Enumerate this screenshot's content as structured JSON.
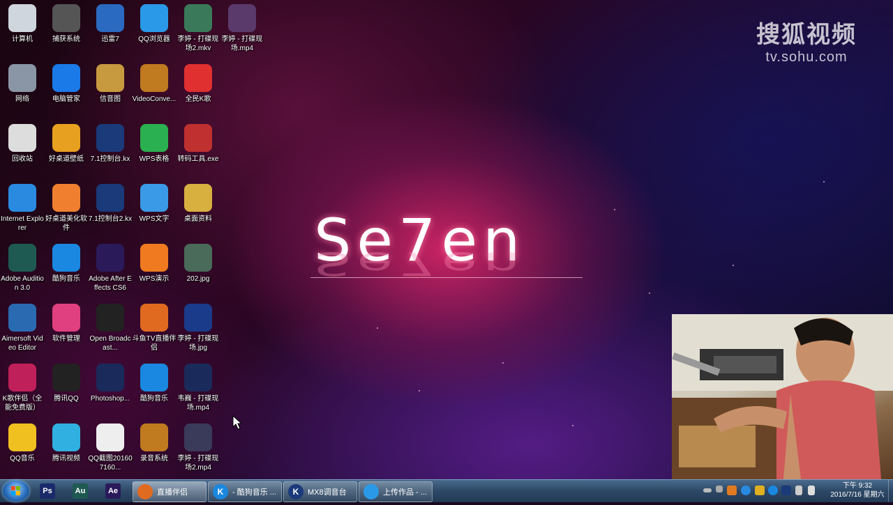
{
  "watermark": {
    "brand": "搜狐视频",
    "url": "tv.sohu.com"
  },
  "wallpaper_logo": {
    "text": "Se7en"
  },
  "desktop_icons": [
    {
      "label": "计算机",
      "icon": "computer-icon",
      "color": "#cfd6de"
    },
    {
      "label": "网络",
      "icon": "network-globe-icon",
      "color": "#8a96a6"
    },
    {
      "label": "回收站",
      "icon": "recycle-bin-icon",
      "color": "#dddddd"
    },
    {
      "label": "Internet Explorer",
      "icon": "internet-explorer-icon",
      "color": "#2a8ae0"
    },
    {
      "label": "Adobe Audition 3.0",
      "icon": "adobe-audition-icon",
      "color": "#1e5a52"
    },
    {
      "label": "Aimersoft Video Editor",
      "icon": "aimersoft-video-editor-icon",
      "color": "#2a6ab0"
    },
    {
      "label": "K歌伴侣（全能免费版）",
      "icon": "k-song-companion-icon",
      "color": "#c0205a"
    },
    {
      "label": "QQ音乐",
      "icon": "qq-music-icon",
      "color": "#f0c020"
    },
    {
      "label": "捕获系统",
      "icon": "capture-system-icon",
      "color": "#555555"
    },
    {
      "label": "电脑管家",
      "icon": "pc-manager-icon",
      "color": "#1a7ae8"
    },
    {
      "label": "好桌道壁纸",
      "icon": "wallpaper-app-icon",
      "color": "#e8a020"
    },
    {
      "label": "好桌道美化软件",
      "icon": "desktop-beautify-icon",
      "color": "#f08030"
    },
    {
      "label": "酷狗音乐",
      "icon": "kugou-music-icon",
      "color": "#1a88e0"
    },
    {
      "label": "软件管理",
      "icon": "software-manager-icon",
      "color": "#e04080"
    },
    {
      "label": "腾讯QQ",
      "icon": "tencent-qq-icon",
      "color": "#222222"
    },
    {
      "label": "腾讯视频",
      "icon": "tencent-video-icon",
      "color": "#30b0e0"
    },
    {
      "label": "迅雷7",
      "icon": "xunlei-thunder-icon",
      "color": "#2a6ac0"
    },
    {
      "label": "信音图",
      "icon": "folder-icon",
      "color": "#c89a40"
    },
    {
      "label": "7.1控制台.kx",
      "icon": "kx-console-icon",
      "color": "#1a3a7a"
    },
    {
      "label": "7.1控制台2.kx",
      "icon": "kx-console-icon",
      "color": "#1a3a7a"
    },
    {
      "label": "Adobe After Effects CS6",
      "icon": "after-effects-icon",
      "color": "#2a1a5a"
    },
    {
      "label": "Open Broadcast...",
      "icon": "obs-icon",
      "color": "#222222"
    },
    {
      "label": "Photoshop...",
      "icon": "photoshop-icon",
      "color": "#1a2a5a"
    },
    {
      "label": "QQ截图201607160...",
      "icon": "image-file-icon",
      "color": "#eeeeee"
    },
    {
      "label": "QQ浏览器",
      "icon": "qq-browser-icon",
      "color": "#2a9ae8"
    },
    {
      "label": "VideoConve...",
      "icon": "video-converter-icon",
      "color": "#c07a20"
    },
    {
      "label": "WPS表格",
      "icon": "wps-spreadsheet-icon",
      "color": "#2ab050"
    },
    {
      "label": "WPS文字",
      "icon": "wps-writer-icon",
      "color": "#3a9ae8"
    },
    {
      "label": "WPS演示",
      "icon": "wps-presentation-icon",
      "color": "#f07a20"
    },
    {
      "label": "斗鱼TV直播伴侣",
      "icon": "douyu-tv-icon",
      "color": "#e06a20"
    },
    {
      "label": "酷狗音乐",
      "icon": "kugou-music-icon",
      "color": "#1a88e0"
    },
    {
      "label": "录音系统",
      "icon": "recording-system-icon",
      "color": "#c07a20"
    },
    {
      "label": "李婷 - 打碟现场2.mkv",
      "icon": "mkv-video-icon",
      "color": "#3a7a5a"
    },
    {
      "label": "全民K歌",
      "icon": "quanmin-ksong-icon",
      "color": "#e03030"
    },
    {
      "label": "转码工具.exe",
      "icon": "transcoder-icon",
      "color": "#c03030"
    },
    {
      "label": "桌面资料",
      "icon": "folder-icon",
      "color": "#d8b040"
    },
    {
      "label": "202.jpg",
      "icon": "image-file-icon",
      "color": "#4a6a5a"
    },
    {
      "label": "李婷 - 打碟现场.jpg",
      "icon": "image-file-icon",
      "color": "#1a3a8a"
    },
    {
      "label": "韦巍 - 打碟现场.mp4",
      "icon": "mp4-video-icon",
      "color": "#1a2a5a"
    },
    {
      "label": "李婷 - 打碟现场2.mp4",
      "icon": "mp4-video-icon",
      "color": "#3a3a5a"
    },
    {
      "label": "李婷 - 打碟现场.mp4",
      "icon": "mp4-video-icon",
      "color": "#5a3a6a"
    }
  ],
  "taskbar": {
    "pinned": [
      {
        "name": "photoshop",
        "abbr": "Ps",
        "color": "#1a2a6a"
      },
      {
        "name": "audition",
        "abbr": "Au",
        "color": "#1e5a52"
      },
      {
        "name": "after-effects",
        "abbr": "Ae",
        "color": "#2a1a5a"
      }
    ],
    "tasks": [
      {
        "label": "直播伴侣",
        "icon_text": "",
        "color": "#e06a20",
        "active": true
      },
      {
        "label": "- 酷狗音乐 ...",
        "icon_text": "K",
        "color": "#1a88e0",
        "active": false
      },
      {
        "label": "MX8调音台",
        "icon_text": "K",
        "color": "#1a3a7a",
        "active": false
      },
      {
        "label": "上传作品 - ...",
        "icon_text": "",
        "color": "#2a9ae8",
        "active": false
      }
    ],
    "clock": {
      "time": "下午 9:32",
      "date": "2016/7/16 星期六"
    }
  }
}
